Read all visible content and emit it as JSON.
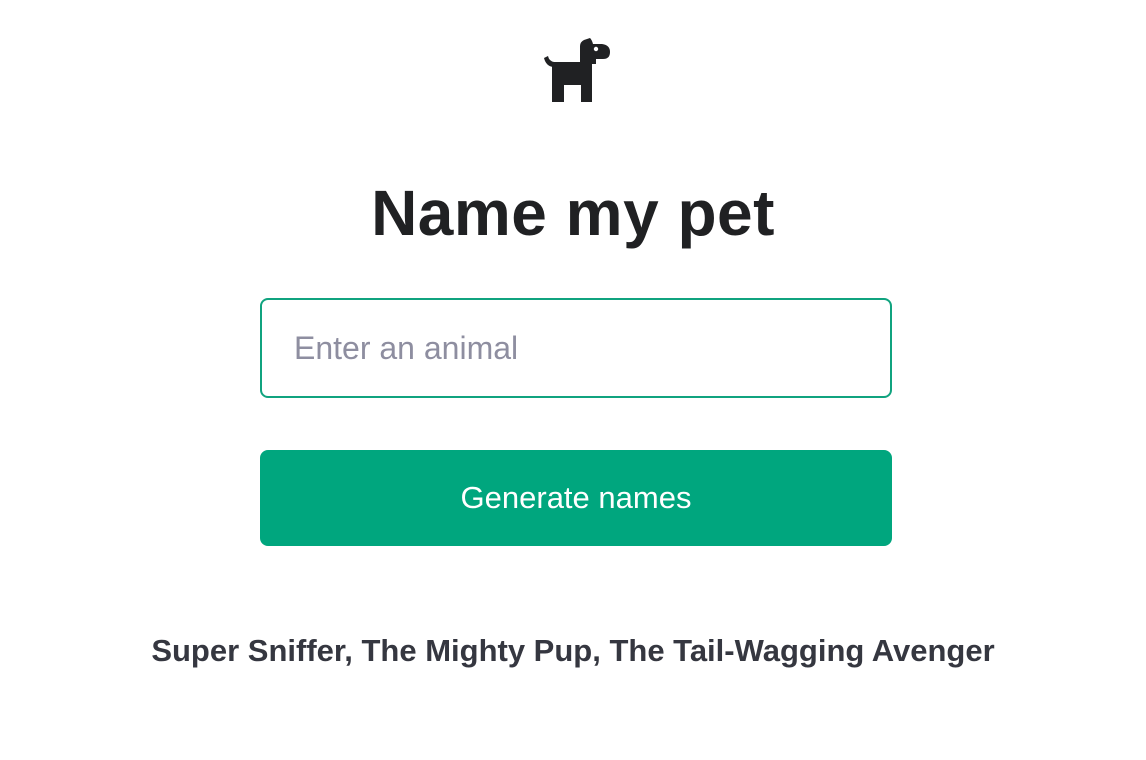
{
  "header": {
    "logo_icon": "dog-icon",
    "title": "Name my pet"
  },
  "form": {
    "animal_input": {
      "value": "",
      "placeholder": "Enter an animal"
    },
    "submit_label": "Generate names"
  },
  "result": {
    "text": "Super Sniffer, The Mighty Pup, The Tail-Wagging Avenger"
  },
  "colors": {
    "accent": "#10a37f",
    "button": "#00a67e",
    "title": "#202123",
    "result": "#353740",
    "placeholder": "#8e8ea0"
  }
}
